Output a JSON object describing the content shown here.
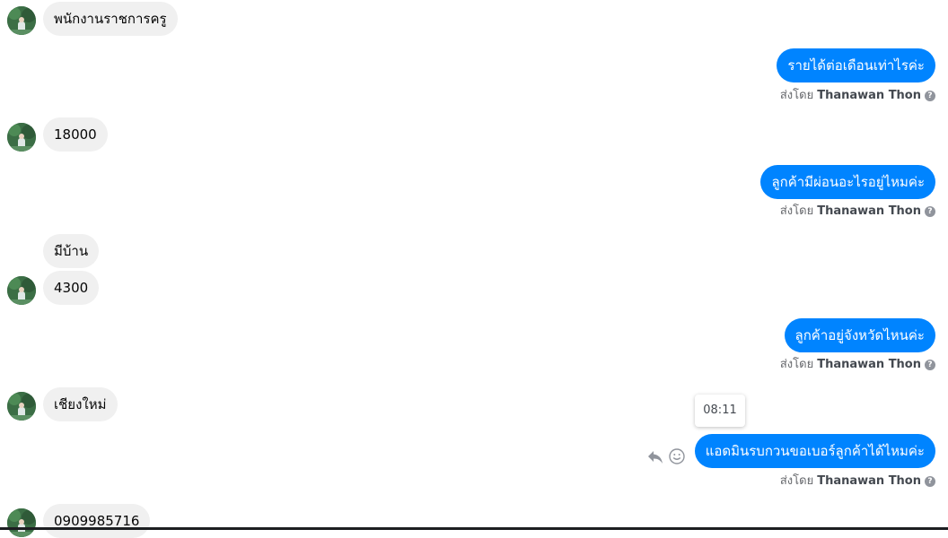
{
  "contact": {
    "avatar_icon": "contact-avatar"
  },
  "messages": [
    {
      "side": "in",
      "text": "พนักงานราชการครู"
    },
    {
      "side": "out",
      "text": "รายได้ต่อเดือนเท่าไรค่ะ"
    },
    {
      "side": "in",
      "text": "18000"
    },
    {
      "side": "out",
      "text": "ลูกค้ามีผ่อนอะไรอยู่ไหมค่ะ"
    },
    {
      "side": "in",
      "text": "มีบ้าน"
    },
    {
      "side": "in",
      "text": "4300"
    },
    {
      "side": "out",
      "text": "ลูกค้าอยู่จังหวัดไหนค่ะ"
    },
    {
      "side": "in",
      "text": "เชียงใหม่"
    },
    {
      "side": "out",
      "text": "แอดมินรบกวนขอเบอร์ลูกค้าได้ไหมค่ะ"
    },
    {
      "side": "in",
      "text": "0909985716"
    }
  ],
  "sent_by": {
    "prefix": "ส่งโดย",
    "name": "Thanawan Thon",
    "help_icon": "question-icon"
  },
  "tooltip": {
    "time": "08:11"
  },
  "actions": {
    "reply_icon": "reply-icon",
    "react_icon": "smiley-icon"
  },
  "colors": {
    "outgoing_bubble": "#0084ff",
    "incoming_bubble": "#f0f0f0"
  }
}
